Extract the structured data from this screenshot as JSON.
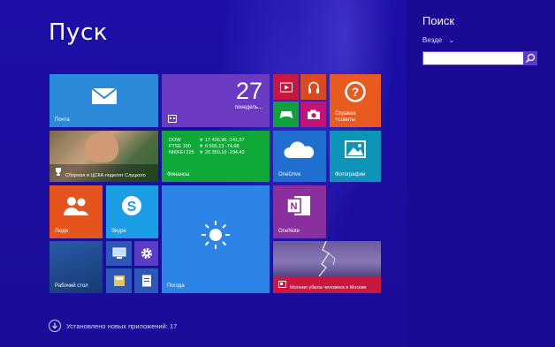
{
  "start": {
    "title": "Пуск"
  },
  "tiles": {
    "mail": {
      "label": "Почта",
      "color": "#2b8ad8"
    },
    "calendar": {
      "day": "27",
      "weekday": "понедель...",
      "color": "#6a3ac2"
    },
    "video": {
      "color": "#c9173d"
    },
    "music": {
      "color": "#d94a1e"
    },
    "games": {
      "color": "#10a23a"
    },
    "camera": {
      "color": "#c0147a"
    },
    "help": {
      "label": "Справка\n+советы",
      "color": "#e85a1e"
    },
    "sport": {
      "label": "Сборная и ЦСКА поделят Слуцкого",
      "color": "#2f6b2d"
    },
    "finance": {
      "label": "Финансы",
      "color": "#11a83a",
      "rows": [
        {
          "name": "DOW",
          "value": "▼ 17 426,96 -141,57"
        },
        {
          "name": "FTSE 100",
          "value": "▼ 6 505,13 -74,68"
        },
        {
          "name": "NIKKEI 225",
          "value": "▼ 20 350,10 -194,43"
        }
      ]
    },
    "onedrive": {
      "label": "OneDrive",
      "color": "#1f6fd0"
    },
    "photos": {
      "label": "Фотографии",
      "color": "#0c95b8"
    },
    "people": {
      "label": "Люди",
      "color": "#e4541c"
    },
    "skype": {
      "label": "Skype",
      "color": "#1b9ee6"
    },
    "weather": {
      "label": "Погода",
      "color": "#2b84e6"
    },
    "onenote": {
      "label": "OneNote",
      "color": "#8a2f9e"
    },
    "desktop": {
      "label": "Рабочий стол",
      "color": "#1c3f7a"
    },
    "computer": {
      "color": "#2d57b8"
    },
    "settings": {
      "color": "#5b3cc4"
    },
    "explorer": {
      "color": "#c9a437"
    },
    "docs": {
      "color": "#2d57b8"
    },
    "news": {
      "label": "Молния убила человека в Москве",
      "color": "#c9173d"
    }
  },
  "footer": {
    "text": "Установлено новых приложений: 17"
  },
  "search_charm": {
    "title": "Поиск",
    "scope": "Везде",
    "placeholder": ""
  }
}
